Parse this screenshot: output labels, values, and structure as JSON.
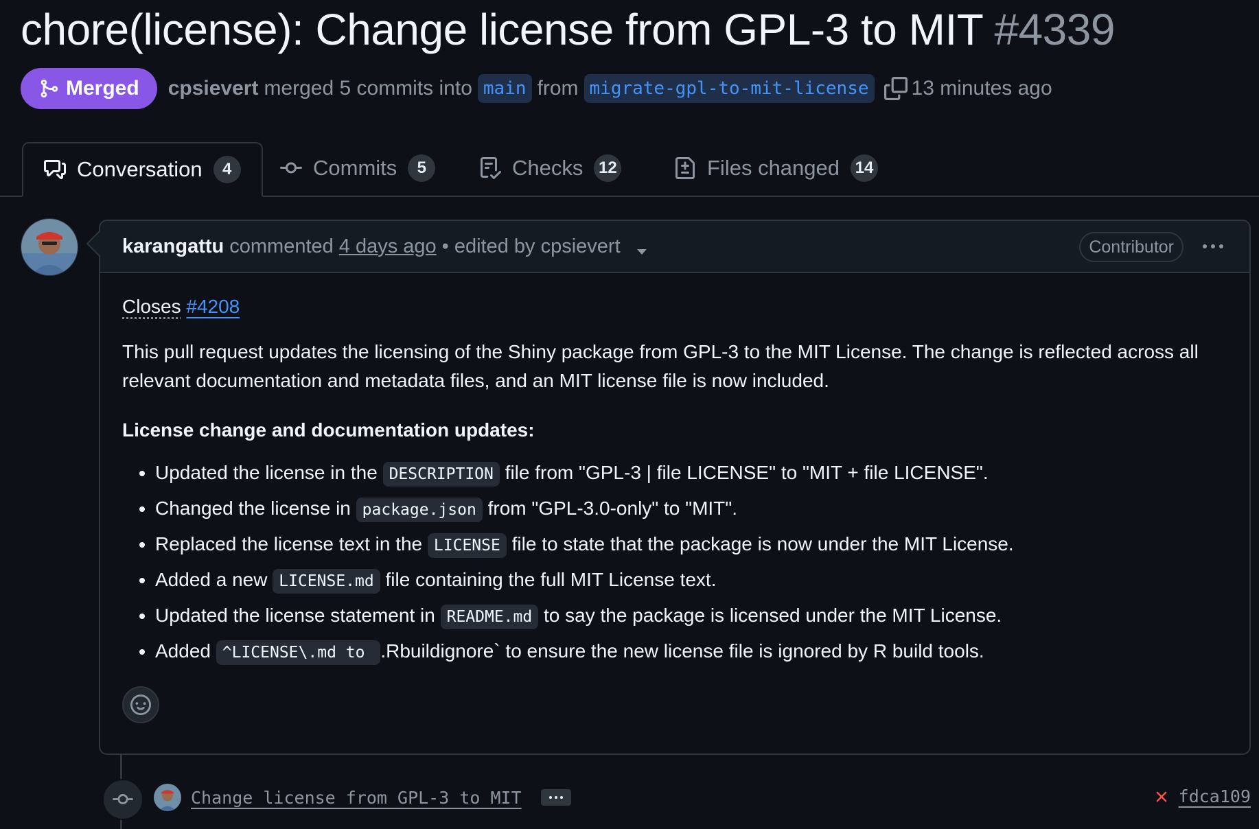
{
  "pr": {
    "title": "chore(license): Change license from GPL-3 to MIT",
    "number": "#4339",
    "status": "Merged",
    "merger": "cpsievert",
    "merge_text_1": "merged 5 commits into",
    "base_branch": "main",
    "from_text": "from",
    "head_branch": "migrate-gpl-to-mit-license",
    "time": "13 minutes ago"
  },
  "tabs": [
    {
      "label": "Conversation",
      "count": "4",
      "icon": "comment-discussion-icon"
    },
    {
      "label": "Commits",
      "count": "5",
      "icon": "git-commit-icon"
    },
    {
      "label": "Checks",
      "count": "12",
      "icon": "checklist-icon"
    },
    {
      "label": "Files changed",
      "count": "14",
      "icon": "file-diff-icon"
    }
  ],
  "comment": {
    "author": "karangattu",
    "action": "commented",
    "time": "4 days ago",
    "separator": "•",
    "edited": "edited by cpsievert",
    "role": "Contributor",
    "closes_label": "Closes",
    "closes_ref": "#4208",
    "intro": "This pull request updates the licensing of the Shiny package from GPL-3 to the MIT License. The change is reflected across all relevant documentation and metadata files, and an MIT license file is now included.",
    "heading": "License change and documentation updates:",
    "bullets": [
      {
        "pre": "Updated the license in the",
        "code": "DESCRIPTION",
        "post": "file from \"GPL-3 | file LICENSE\" to \"MIT + file LICENSE\"."
      },
      {
        "pre": "Changed the license in",
        "code": "package.json",
        "post": "from \"GPL-3.0-only\" to \"MIT\"."
      },
      {
        "pre": "Replaced the license text in the",
        "code": "LICENSE",
        "post": "file to state that the package is now under the MIT License."
      },
      {
        "pre": "Added a new",
        "code": "LICENSE.md",
        "post": "file containing the full MIT License text."
      },
      {
        "pre": "Updated the license statement in",
        "code": "README.md",
        "post": "to say the package is licensed under the MIT License."
      },
      {
        "pre": "Added",
        "code": "^LICENSE\\.md to ",
        "post": ".Rbuildignore` to ensure the new license file is ignored by R build tools."
      }
    ]
  },
  "timeline": {
    "commit_message": "Change license from GPL-3 to MIT",
    "commit_sha": "fdca109",
    "commit_status": "failed"
  },
  "colors": {
    "background": "#0d1117",
    "merged": "#8957e5",
    "link": "#4493f8",
    "fail": "#f85149"
  }
}
